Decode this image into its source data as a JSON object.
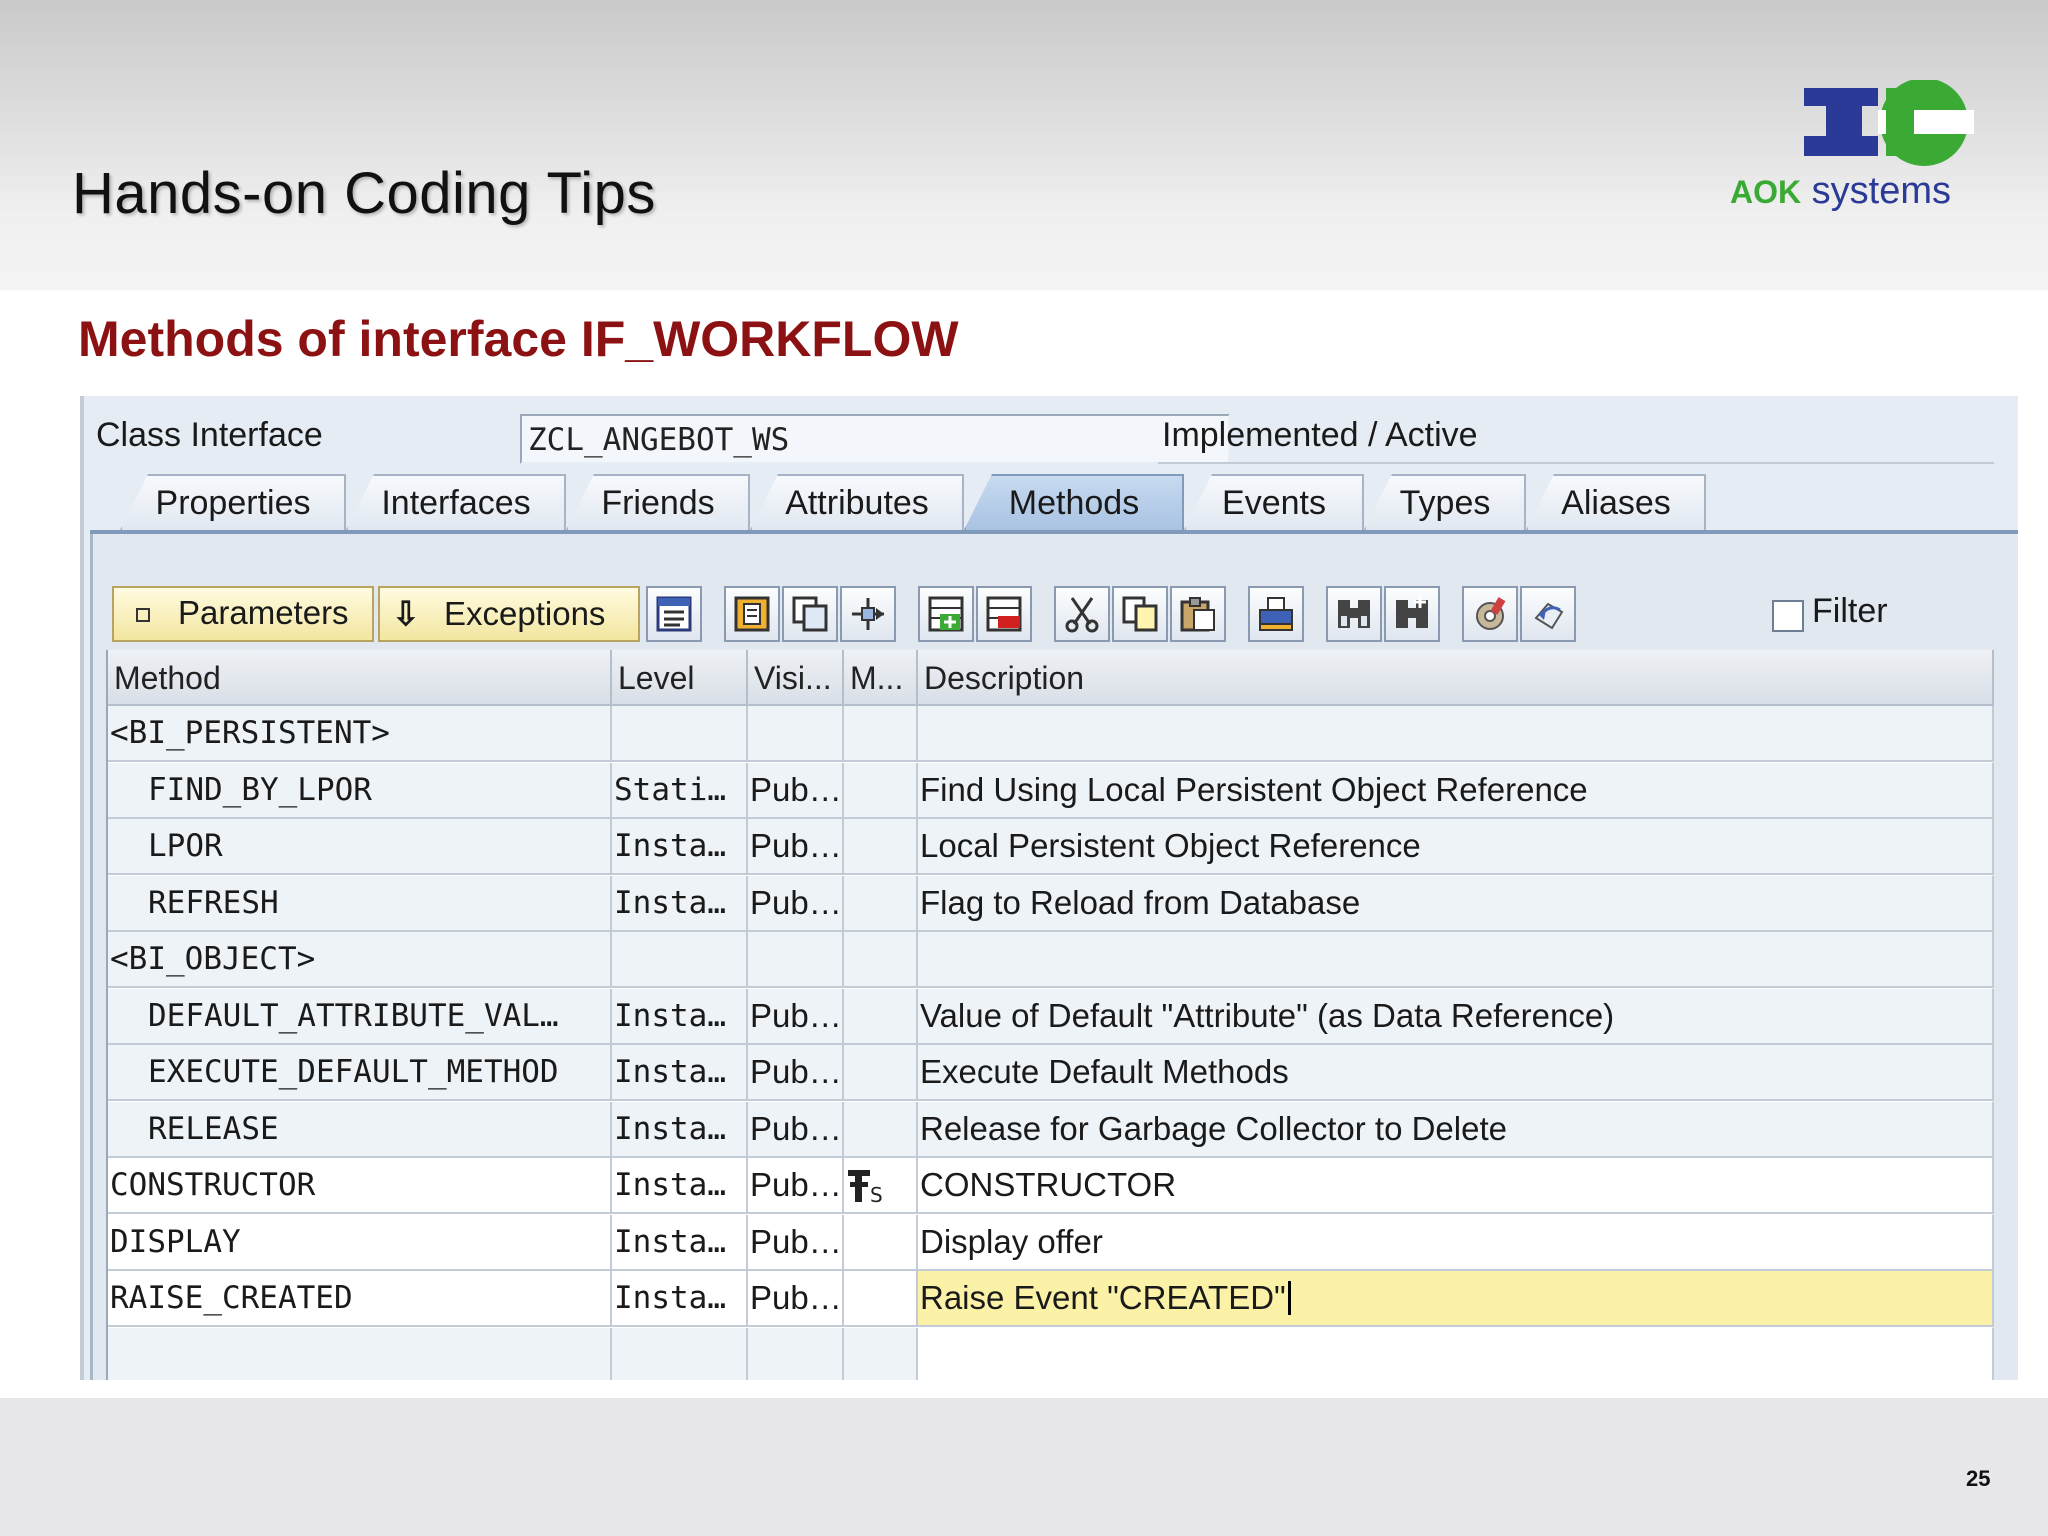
{
  "slide": {
    "title": "Hands-on Coding Tips",
    "subtitle": "Methods of interface IF_WORKFLOW",
    "page_number": "25"
  },
  "logo": {
    "aok": "AOK",
    "systems": "systems",
    "colors": {
      "blue": "#2b3a97",
      "green": "#3aaa35"
    }
  },
  "sap": {
    "class_interface_label": "Class Interface",
    "class_interface_value": "ZCL_ANGEBOT_WS",
    "status": "Implemented / Active",
    "tabs": [
      "Properties",
      "Interfaces",
      "Friends",
      "Attributes",
      "Methods",
      "Events",
      "Types",
      "Aliases"
    ],
    "active_tab": "Methods",
    "toolbar": {
      "parameters_label": "Parameters",
      "exceptions_label": "Exceptions",
      "filter_label": "Filter",
      "icons": [
        "detail-view-icon",
        "source-code-icon",
        "copy-object-icon",
        "navigate-icon",
        "insert-row-icon",
        "delete-row-icon",
        "cut-icon",
        "copy-icon",
        "paste-icon",
        "print-icon",
        "find-icon",
        "find-next-icon",
        "settings-icon",
        "undo-icon"
      ]
    },
    "columns": [
      "Method",
      "Level",
      "Visi...",
      "M...",
      "Description"
    ],
    "rows": [
      {
        "method": "<BI_PERSISTENT>",
        "level": "",
        "visibility": "",
        "m": "",
        "description": "",
        "group": true
      },
      {
        "method": "FIND_BY_LPOR",
        "level": "Stati…",
        "visibility": "Pub…",
        "m": "",
        "description": "Find Using Local Persistent Object Reference",
        "indent": true
      },
      {
        "method": "LPOR",
        "level": "Insta…",
        "visibility": "Pub…",
        "m": "",
        "description": "Local Persistent Object Reference",
        "indent": true
      },
      {
        "method": "REFRESH",
        "level": "Insta…",
        "visibility": "Pub…",
        "m": "",
        "description": "Flag to Reload from Database",
        "indent": true
      },
      {
        "method": "<BI_OBJECT>",
        "level": "",
        "visibility": "",
        "m": "",
        "description": "",
        "group": true
      },
      {
        "method": "DEFAULT_ATTRIBUTE_VAL…",
        "level": "Insta…",
        "visibility": "Pub…",
        "m": "",
        "description": "Value of Default \"Attribute\" (as Data Reference)",
        "indent": true
      },
      {
        "method": "EXECUTE_DEFAULT_METHOD",
        "level": "Insta…",
        "visibility": "Pub…",
        "m": "",
        "description": "Execute Default Methods",
        "indent": true
      },
      {
        "method": "RELEASE",
        "level": "Insta…",
        "visibility": "Pub…",
        "m": "",
        "description": "Release for Garbage Collector to Delete",
        "indent": true
      },
      {
        "method": "CONSTRUCTOR",
        "level": "Insta…",
        "visibility": "Pub…",
        "m": "constructor-icon",
        "description": "CONSTRUCTOR"
      },
      {
        "method": "DISPLAY",
        "level": "Insta…",
        "visibility": "Pub…",
        "m": "",
        "description": "Display offer"
      },
      {
        "method": "RAISE_CREATED",
        "level": "Insta…",
        "visibility": "Pub…",
        "m": "",
        "description": "Raise Event \"CREATED\"",
        "highlight": true
      },
      {
        "method": "",
        "level": "",
        "visibility": "",
        "m": "",
        "description": ""
      }
    ]
  }
}
